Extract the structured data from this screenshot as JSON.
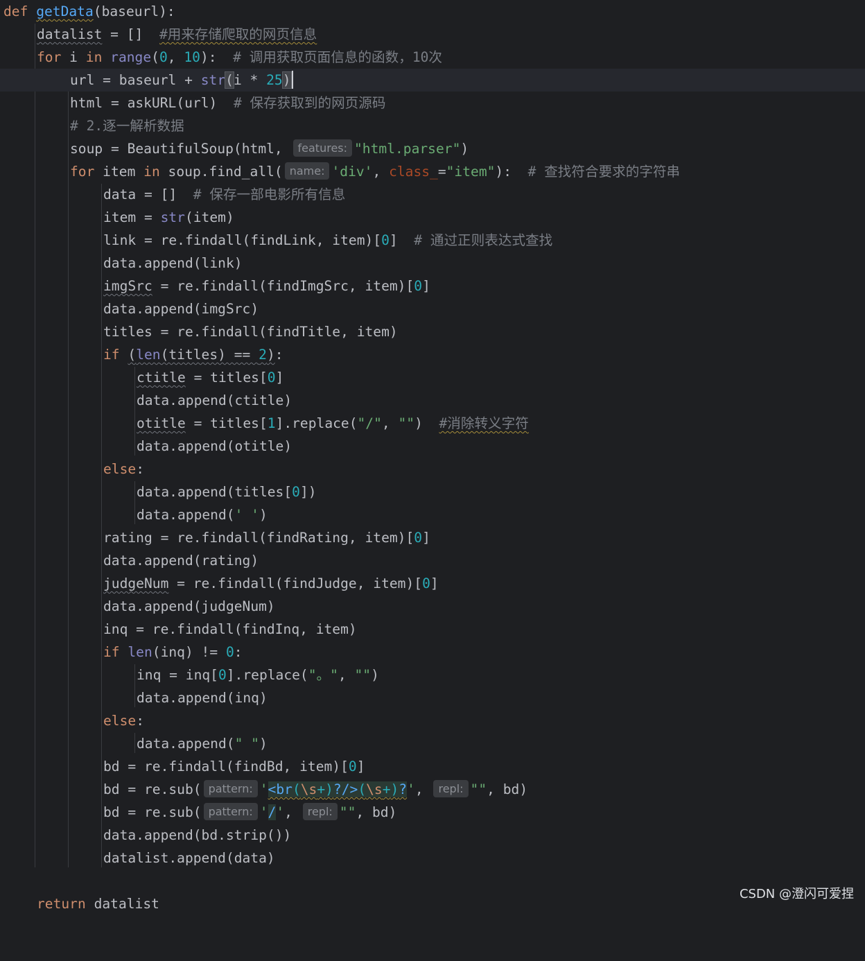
{
  "editor": {
    "l1": {
      "def": "def",
      "fn": "getData",
      "open": "(",
      "param": "baseurl",
      "close": "):"
    },
    "l2": {
      "var": "datalist",
      "rest": " = []  ",
      "comment": "#用来存储爬取的网页信息"
    },
    "l3": {
      "kw_for": "for",
      "a": " i ",
      "kw_in": "in",
      "sp": " ",
      "range": "range",
      "open": "(",
      "n0": "0",
      "comma": ", ",
      "n10": "10",
      "close": "):  ",
      "comment": "# 调用获取页面信息的函数，10次"
    },
    "l4": {
      "a": "url = baseurl + ",
      "str": "str",
      "open": "(",
      "b": "i * ",
      "n25": "25",
      "close": ")"
    },
    "l5": {
      "a": "html = askURL(url)  ",
      "comment": "# 保存获取到的网页源码"
    },
    "l6": {
      "comment": "# 2.逐一解析数据"
    },
    "l7": {
      "a": "soup = BeautifulSoup(html, ",
      "hint": "features:",
      "str": "\"html.parser\"",
      "close": ")"
    },
    "l8": {
      "kw_for": "for",
      "a": " item ",
      "kw_in": "in",
      "b": " soup.find_all(",
      "hint": "name:",
      "str1": "'div'",
      "c": ", ",
      "kwarg": "class_",
      "eq": "=",
      "str2": "\"item\"",
      "close": "):  ",
      "comment": "# 查找符合要求的字符串"
    },
    "l9": {
      "a": "data = []  ",
      "comment": "# 保存一部电影所有信息"
    },
    "l10": {
      "a": "item = ",
      "str": "str",
      "b": "(item)"
    },
    "l11": {
      "a": "link = re.findall(findLink, item)[",
      "n": "0",
      "b": "]  ",
      "comment": "# 通过正则表达式查找"
    },
    "l12": {
      "a": "data.append(link)"
    },
    "l13": {
      "var": "imgSrc",
      "a": " = re.findall(findImgSrc, item)[",
      "n": "0",
      "b": "]"
    },
    "l14": {
      "a": "data.append(imgSrc)"
    },
    "l15": {
      "a": "titles = re.findall(findTitle, item)"
    },
    "l16": {
      "kw": "if",
      "sp": " ",
      "open": "(",
      "len": "len",
      "b": "(titles) == ",
      "n": "2",
      "close": ")",
      "colon": ":"
    },
    "l17": {
      "var": "ctitle",
      "a": " = titles[",
      "n": "0",
      "b": "]"
    },
    "l18": {
      "a": "data.append(ctitle)"
    },
    "l19": {
      "var": "otitle",
      "a": " = titles[",
      "n": "1",
      "b": "].replace(",
      "s1": "\"/\"",
      "c": ", ",
      "s2": "\"\"",
      "d": ")  ",
      "comment": "#消除转义字符"
    },
    "l20": {
      "a": "data.append(otitle)"
    },
    "l21": {
      "kw": "else",
      "colon": ":"
    },
    "l22": {
      "a": "data.append(titles[",
      "n": "0",
      "b": "])"
    },
    "l23": {
      "a": "data.append(",
      "s": "' '",
      "b": ")"
    },
    "l24": {
      "a": "rating = re.findall(findRating, item)[",
      "n": "0",
      "b": "]"
    },
    "l25": {
      "a": "data.append(rating)"
    },
    "l26": {
      "var": "judgeNum",
      "a": " = re.findall(findJudge, item)[",
      "n": "0",
      "b": "]"
    },
    "l27": {
      "a": "data.append(judgeNum)"
    },
    "l28": {
      "a": "inq = re.findall(findInq, item)"
    },
    "l29": {
      "kw": "if",
      "sp": " ",
      "len": "len",
      "b": "(inq) != ",
      "n": "0",
      "colon": ":"
    },
    "l30": {
      "a": "inq = inq[",
      "n": "0",
      "b": "].replace(",
      "s1": "\"。\"",
      "c": ", ",
      "s2": "\"\"",
      "d": ")"
    },
    "l31": {
      "a": "data.append(inq)"
    },
    "l32": {
      "kw": "else",
      "colon": ":"
    },
    "l33": {
      "a": "data.append(",
      "s": "\" \"",
      "b": ")"
    },
    "l34": {
      "a": "bd = re.findall(findBd, item)[",
      "n": "0",
      "b": "]"
    },
    "l35": {
      "a": "bd = re.sub(",
      "hint1": "pattern:",
      "q1": "'",
      "r1": "<br",
      "p1": "(",
      "e1": "\\s",
      "pl1": "+",
      "p2": ")",
      "r2": "?/>",
      "p3": "(",
      "e2": "\\s",
      "pl2": "+",
      "p4": ")",
      "r3": "?",
      "q2": "'",
      "c": ", ",
      "hint2": "repl:",
      "s": "\"\"",
      "d": ", bd)"
    },
    "l36": {
      "a": "bd = re.sub(",
      "hint1": "pattern:",
      "q1": "'",
      "r": "/",
      "q2": "'",
      "c": ", ",
      "hint2": "repl:",
      "s": "\"\"",
      "d": ", bd)"
    },
    "l37": {
      "a": "data.append(bd.strip())"
    },
    "l38": {
      "a": "datalist.append(data)"
    },
    "l40": {
      "kw": "return",
      "a": " datalist"
    }
  },
  "watermark": "CSDN @澄闪可爱捏"
}
